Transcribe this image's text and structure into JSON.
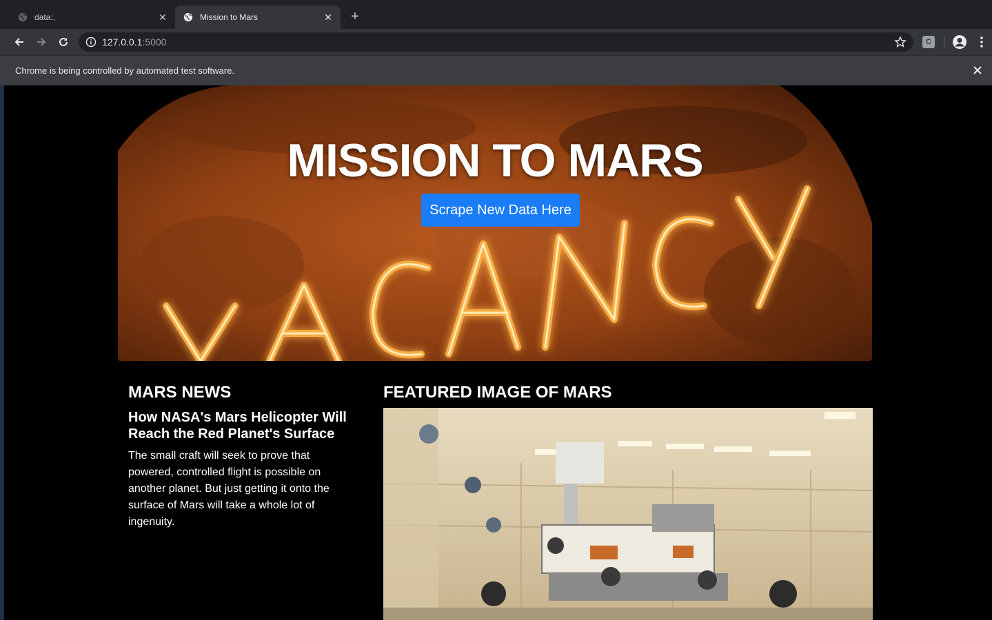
{
  "browser": {
    "tabs": [
      {
        "title": "data:,",
        "active": false
      },
      {
        "title": "Mission to Mars",
        "active": true
      }
    ],
    "url_host": "127.0.0.1",
    "url_port": ":5000",
    "extension_label": "C",
    "infobar_text": "Chrome is being controlled by automated test software."
  },
  "hero": {
    "title": "MISSION TO MARS",
    "button_label": "Scrape New Data Here"
  },
  "news": {
    "heading": "MARS NEWS",
    "title": "How NASA's Mars Helicopter Will Reach the Red Planet's Surface",
    "paragraph": "The small craft will seek to prove that powered, controlled flight is possible on another planet. But just getting it onto the surface of Mars will take a whole lot of ingenuity."
  },
  "featured": {
    "heading": "FEATURED IMAGE OF MARS"
  },
  "colors": {
    "button_blue": "#1a7cf7",
    "chrome_dark": "#202124",
    "chrome_toolbar": "#35363a"
  }
}
